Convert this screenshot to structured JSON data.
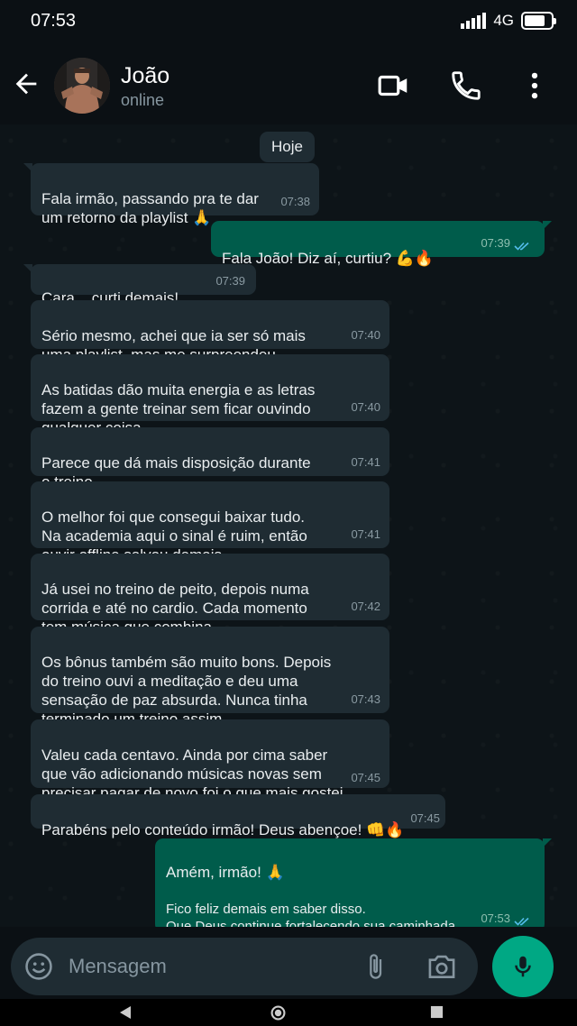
{
  "status_bar": {
    "time": "07:53",
    "network": "4G"
  },
  "header": {
    "contact_name": "João",
    "contact_status": "online"
  },
  "chat": {
    "date_chip": "Hoje",
    "messages": [
      {
        "dir": "in",
        "text": "Fala irmão, passando pra te dar\num retorno da playlist 🙏",
        "time": "07:38"
      },
      {
        "dir": "out",
        "text": "Fala João! Diz aí, curtiu? 💪🔥",
        "time": "07:39"
      },
      {
        "dir": "in",
        "text": "Cara... curti demais!",
        "time": "07:39"
      },
      {
        "dir": "in",
        "text": "Sério mesmo, achei que ia ser só mais\numa playlist, mas me surpreendeu.",
        "time": "07:40"
      },
      {
        "dir": "in",
        "text": "As batidas dão muita energia e as letras\nfazem a gente treinar sem ficar ouvindo\nqualquer coisa.",
        "time": "07:40"
      },
      {
        "dir": "in",
        "text": "Parece que dá mais disposição durante\no treino.",
        "time": "07:41"
      },
      {
        "dir": "in",
        "text": "O melhor foi que consegui baixar tudo.\nNa academia aqui o sinal é ruim, então\nouvir offline salvou demais.",
        "time": "07:41"
      },
      {
        "dir": "in",
        "text": "Já usei no treino de peito, depois numa\ncorrida e até no cardio. Cada momento\ntem música que combina.",
        "time": "07:42"
      },
      {
        "dir": "in",
        "text": "Os bônus também são muito bons. Depois\ndo treino ouvi a meditação e deu uma\nsensação de paz absurda. Nunca tinha\nterminado um treino assim.",
        "time": "07:43"
      },
      {
        "dir": "in",
        "text": "Valeu cada centavo. Ainda por cima saber\nque vão adicionando músicas novas sem\nprecisar pagar de novo foi o que mais gostei.",
        "time": "07:45"
      },
      {
        "dir": "in",
        "text": "Parabéns pelo conteúdo irmão! Deus abençoe! 👊🔥",
        "time": "07:45"
      },
      {
        "dir": "out",
        "title": "Amém, irmão! 🙏",
        "text": "Fico feliz demais em saber disso.\nQue Deus continue fortalecendo sua caminhada\ne seus treinos. Qualquer novidade é só me chamar! 💪🔥",
        "time": "07:53"
      }
    ]
  },
  "composer": {
    "placeholder": "Mensagem"
  },
  "colors": {
    "incoming_bubble": "#1f2c33",
    "outgoing_bubble": "#005c4b",
    "accent": "#00a884",
    "read_ticks": "#53bdeb"
  },
  "icons": [
    "back-arrow-icon",
    "video-call-icon",
    "phone-icon",
    "more-options-icon",
    "emoji-icon",
    "attach-icon",
    "camera-icon",
    "mic-icon"
  ]
}
